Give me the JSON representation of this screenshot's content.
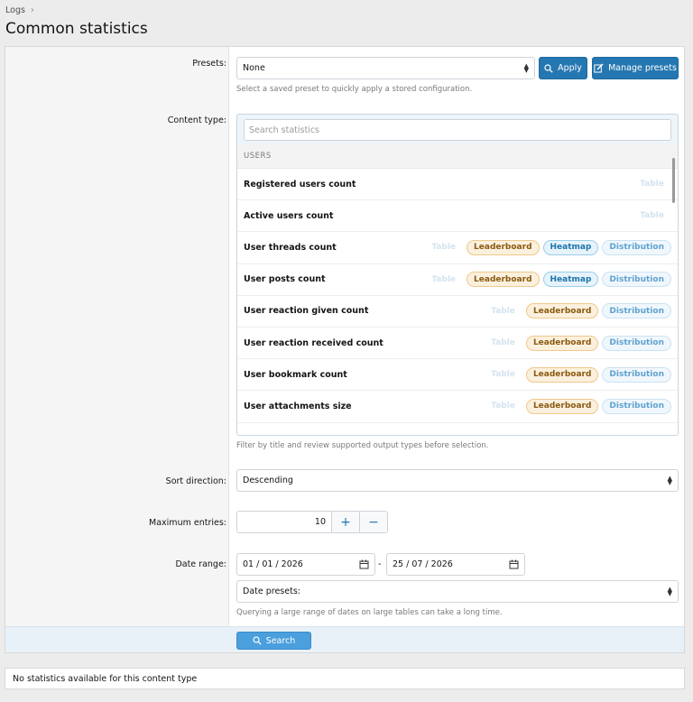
{
  "breadcrumb": {
    "item": "Logs",
    "separator": "›"
  },
  "page_title": "Common statistics",
  "presets": {
    "label": "Presets:",
    "selected": "None",
    "apply_label": "Apply",
    "manage_label": "Manage presets",
    "explain": "Select a saved preset to quickly apply a stored configuration."
  },
  "content_type": {
    "label": "Content type:",
    "search_placeholder": "Search statistics",
    "group": "USERS",
    "items": [
      {
        "title": "Registered users count",
        "tags": [
          "Table"
        ]
      },
      {
        "title": "Active users count",
        "tags": [
          "Table"
        ]
      },
      {
        "title": "User threads count",
        "tags": [
          "Table",
          "Leaderboard",
          "Heatmap",
          "Distribution"
        ]
      },
      {
        "title": "User posts count",
        "tags": [
          "Table",
          "Leaderboard",
          "Heatmap",
          "Distribution"
        ]
      },
      {
        "title": "User reaction given count",
        "tags": [
          "Table",
          "Leaderboard",
          "Distribution"
        ]
      },
      {
        "title": "User reaction received count",
        "tags": [
          "Table",
          "Leaderboard",
          "Distribution"
        ]
      },
      {
        "title": "User bookmark count",
        "tags": [
          "Table",
          "Leaderboard",
          "Distribution"
        ]
      },
      {
        "title": "User attachments size",
        "tags": [
          "Table",
          "Leaderboard",
          "Distribution"
        ]
      }
    ],
    "explain": "Filter by title and review supported output types before selection."
  },
  "sort_direction": {
    "label": "Sort direction:",
    "selected": "Descending"
  },
  "max_entries": {
    "label": "Maximum entries:",
    "value": "10",
    "plus": "+",
    "minus": "−"
  },
  "date_range": {
    "label": "Date range:",
    "start": "01 / 01 / 2026",
    "end": "25 / 07 / 2026",
    "separator": "-",
    "presets_label": "Date presets:",
    "explain": "Querying a large range of dates on large tables can take a long time."
  },
  "search_button": "Search",
  "no_stats_message": "No statistics available for this content type",
  "colors": {
    "primary": "#2577b1",
    "search_button": "#4a9fdc",
    "leaderboard": "#8a5a12",
    "heatmap": "#1e74ab",
    "distribution": "#5fa2cf"
  }
}
